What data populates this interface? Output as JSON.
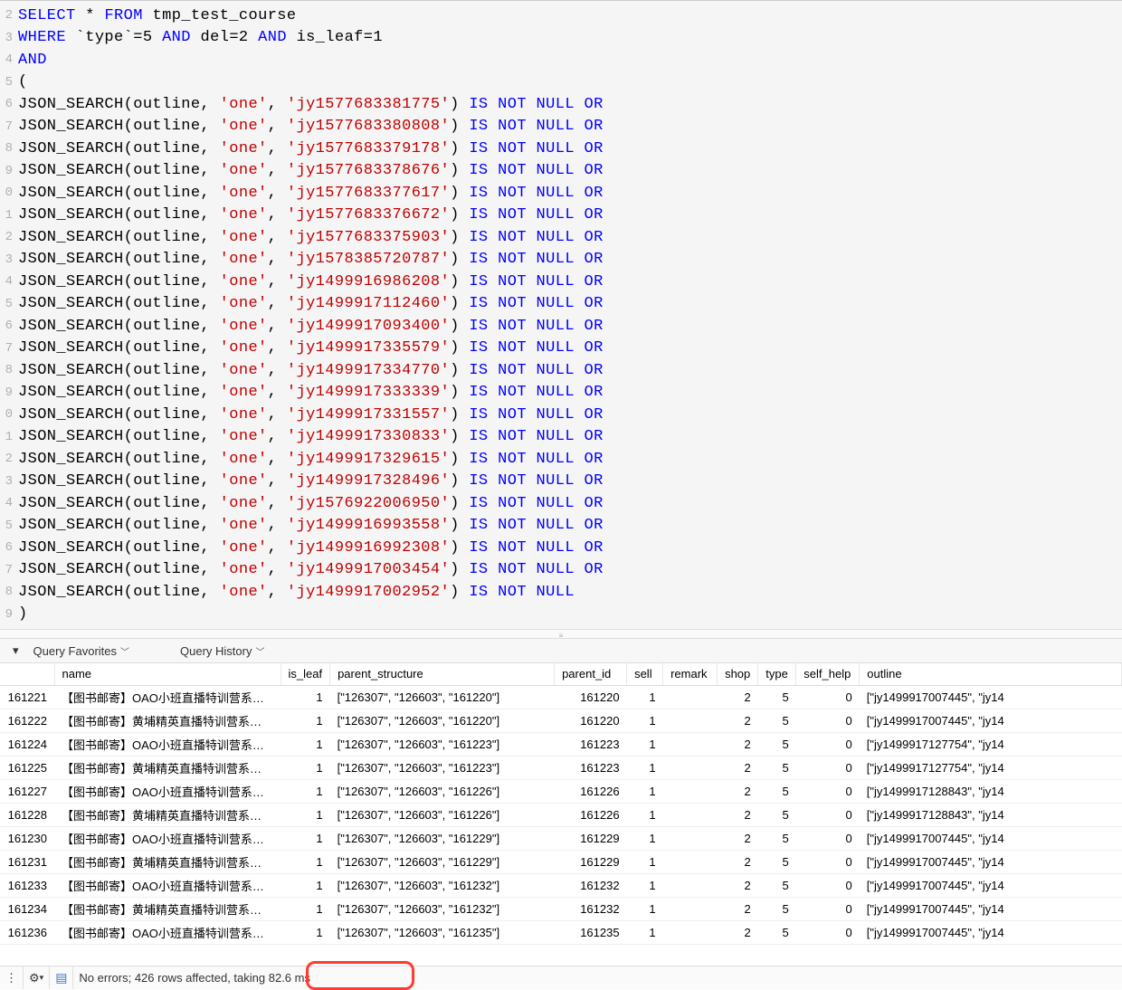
{
  "sql": {
    "lines": [
      2,
      3,
      4,
      5,
      6,
      7,
      8,
      9,
      0,
      1,
      2,
      3,
      4,
      5,
      6,
      7,
      8,
      9,
      0,
      1,
      2,
      3,
      4,
      5,
      6,
      7,
      8,
      9
    ],
    "line1_kw1": "SELECT",
    "line1_star": "*",
    "line1_kw2": "FROM",
    "line1_tbl": "tmp_test_course",
    "line2_kw1": "WHERE",
    "line2_field1": "`type`",
    "line2_eq": "=",
    "line2_v1": "5",
    "line2_and": "AND",
    "line2_field2": "del",
    "line2_v2": "2",
    "line2_field3": "is_leaf",
    "line2_v3": "1",
    "line3_and": "AND",
    "line4_paren": "(",
    "json_func": "JSON_SEARCH",
    "json_arg1": "outline",
    "json_comma": ",",
    "json_one": "'one'",
    "json_rparen": ")",
    "suffix_isnotnull": " IS NOT NULL",
    "suffix_or": " OR",
    "close_paren": ")",
    "ids": [
      "'jy1577683381775'",
      "'jy1577683380808'",
      "'jy1577683379178'",
      "'jy1577683378676'",
      "'jy1577683377617'",
      "'jy1577683376672'",
      "'jy1577683375903'",
      "'jy1578385720787'",
      "'jy1499916986208'",
      "'jy1499917112460'",
      "'jy1499917093400'",
      "'jy1499917335579'",
      "'jy1499917334770'",
      "'jy1499917333339'",
      "'jy1499917331557'",
      "'jy1499917330833'",
      "'jy1499917329615'",
      "'jy1499917328496'",
      "'jy1576922006950'",
      "'jy1499916993558'",
      "'jy1499916992308'",
      "'jy1499917003454'",
      "'jy1499917002952'"
    ]
  },
  "toolbar": {
    "favorites": "Query Favorites",
    "history": "Query History"
  },
  "columns": {
    "name": "name",
    "is_leaf": "is_leaf",
    "parent_structure": "parent_structure",
    "parent_id": "parent_id",
    "sell": "sell",
    "remark": "remark",
    "shop": "shop",
    "type": "type",
    "self_help": "self_help",
    "outline": "outline"
  },
  "rows": [
    {
      "id": "161221",
      "name": "【图书邮寄】OAO小班直播特训营系…",
      "is_leaf": "1",
      "ps": "[\"126307\", \"126603\", \"161220\"]",
      "pid": "161220",
      "sell": "1",
      "remark": "",
      "shop": "2",
      "type": "5",
      "sh": "0",
      "outline": "[\"jy1499917007445\", \"jy14"
    },
    {
      "id": "161222",
      "name": "【图书邮寄】黄埔精英直播特训营系…",
      "is_leaf": "1",
      "ps": "[\"126307\", \"126603\", \"161220\"]",
      "pid": "161220",
      "sell": "1",
      "remark": "",
      "shop": "2",
      "type": "5",
      "sh": "0",
      "outline": "[\"jy1499917007445\", \"jy14"
    },
    {
      "id": "161224",
      "name": "【图书邮寄】OAO小班直播特训营系…",
      "is_leaf": "1",
      "ps": "[\"126307\", \"126603\", \"161223\"]",
      "pid": "161223",
      "sell": "1",
      "remark": "",
      "shop": "2",
      "type": "5",
      "sh": "0",
      "outline": "[\"jy1499917127754\", \"jy14"
    },
    {
      "id": "161225",
      "name": "【图书邮寄】黄埔精英直播特训营系…",
      "is_leaf": "1",
      "ps": "[\"126307\", \"126603\", \"161223\"]",
      "pid": "161223",
      "sell": "1",
      "remark": "",
      "shop": "2",
      "type": "5",
      "sh": "0",
      "outline": "[\"jy1499917127754\", \"jy14"
    },
    {
      "id": "161227",
      "name": "【图书邮寄】OAO小班直播特训营系…",
      "is_leaf": "1",
      "ps": "[\"126307\", \"126603\", \"161226\"]",
      "pid": "161226",
      "sell": "1",
      "remark": "",
      "shop": "2",
      "type": "5",
      "sh": "0",
      "outline": "[\"jy1499917128843\", \"jy14"
    },
    {
      "id": "161228",
      "name": "【图书邮寄】黄埔精英直播特训营系…",
      "is_leaf": "1",
      "ps": "[\"126307\", \"126603\", \"161226\"]",
      "pid": "161226",
      "sell": "1",
      "remark": "",
      "shop": "2",
      "type": "5",
      "sh": "0",
      "outline": "[\"jy1499917128843\", \"jy14"
    },
    {
      "id": "161230",
      "name": "【图书邮寄】OAO小班直播特训营系…",
      "is_leaf": "1",
      "ps": "[\"126307\", \"126603\", \"161229\"]",
      "pid": "161229",
      "sell": "1",
      "remark": "",
      "shop": "2",
      "type": "5",
      "sh": "0",
      "outline": "[\"jy1499917007445\", \"jy14"
    },
    {
      "id": "161231",
      "name": "【图书邮寄】黄埔精英直播特训营系…",
      "is_leaf": "1",
      "ps": "[\"126307\", \"126603\", \"161229\"]",
      "pid": "161229",
      "sell": "1",
      "remark": "",
      "shop": "2",
      "type": "5",
      "sh": "0",
      "outline": "[\"jy1499917007445\", \"jy14"
    },
    {
      "id": "161233",
      "name": "【图书邮寄】OAO小班直播特训营系…",
      "is_leaf": "1",
      "ps": "[\"126307\", \"126603\", \"161232\"]",
      "pid": "161232",
      "sell": "1",
      "remark": "",
      "shop": "2",
      "type": "5",
      "sh": "0",
      "outline": "[\"jy1499917007445\", \"jy14"
    },
    {
      "id": "161234",
      "name": "【图书邮寄】黄埔精英直播特训营系…",
      "is_leaf": "1",
      "ps": "[\"126307\", \"126603\", \"161232\"]",
      "pid": "161232",
      "sell": "1",
      "remark": "",
      "shop": "2",
      "type": "5",
      "sh": "0",
      "outline": "[\"jy1499917007445\", \"jy14"
    },
    {
      "id": "161236",
      "name": "【图书邮寄】OAO小班直播特训营系…",
      "is_leaf": "1",
      "ps": "[\"126307\", \"126603\", \"161235\"]",
      "pid": "161235",
      "sell": "1",
      "remark": "",
      "shop": "2",
      "type": "5",
      "sh": "0",
      "outline": "[\"jy1499917007445\", \"jy14"
    }
  ],
  "status": {
    "text": "No errors; 426 rows affected, taking 82.6 ms"
  }
}
